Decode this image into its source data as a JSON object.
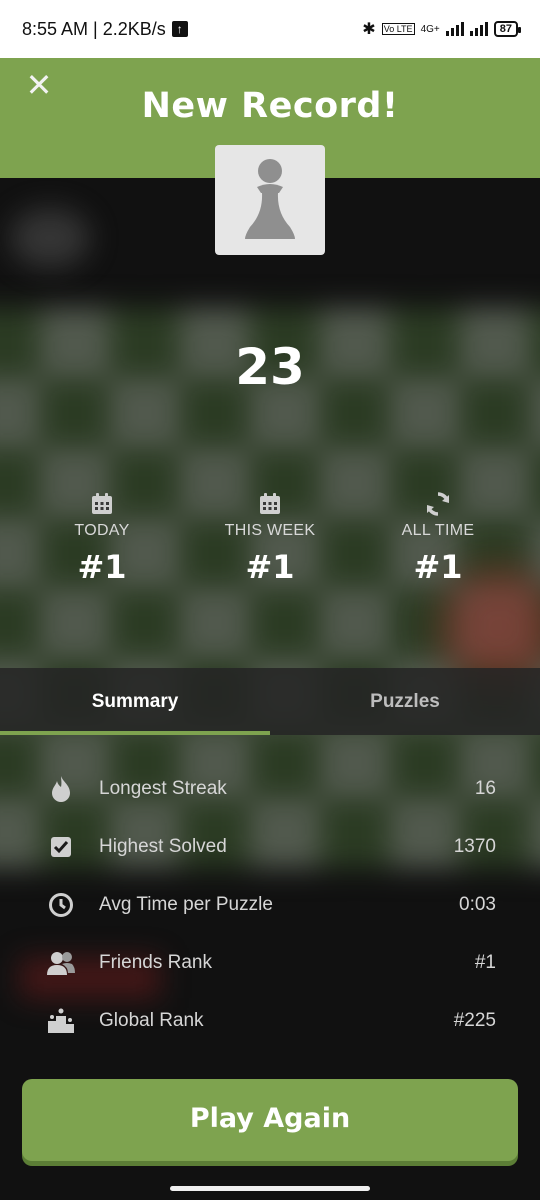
{
  "status_bar": {
    "time_speed": "8:55 AM | 2.2KB/s",
    "network_label": "4G+",
    "battery": "87"
  },
  "header": {
    "title": "New Record!"
  },
  "result": {
    "score": "23"
  },
  "ranks": [
    {
      "label": "TODAY",
      "value": "#1",
      "icon": "calendar-icon"
    },
    {
      "label": "THIS WEEK",
      "value": "#1",
      "icon": "calendar-icon"
    },
    {
      "label": "ALL TIME",
      "value": "#1",
      "icon": "refresh-icon"
    }
  ],
  "tabs": [
    {
      "label": "Summary",
      "active": true
    },
    {
      "label": "Puzzles",
      "active": false
    }
  ],
  "stats": [
    {
      "label": "Longest Streak",
      "value": "16",
      "icon": "flame-icon"
    },
    {
      "label": "Highest Solved",
      "value": "1370",
      "icon": "checkbox-icon"
    },
    {
      "label": "Avg Time per Puzzle",
      "value": "0:03",
      "icon": "clock-icon"
    },
    {
      "label": "Friends Rank",
      "value": "#1",
      "icon": "friends-icon"
    },
    {
      "label": "Global Rank",
      "value": "#225",
      "icon": "podium-icon"
    }
  ],
  "play_button": {
    "label": "Play Again"
  },
  "colors": {
    "accent": "#7ea34f",
    "background": "#151515"
  }
}
